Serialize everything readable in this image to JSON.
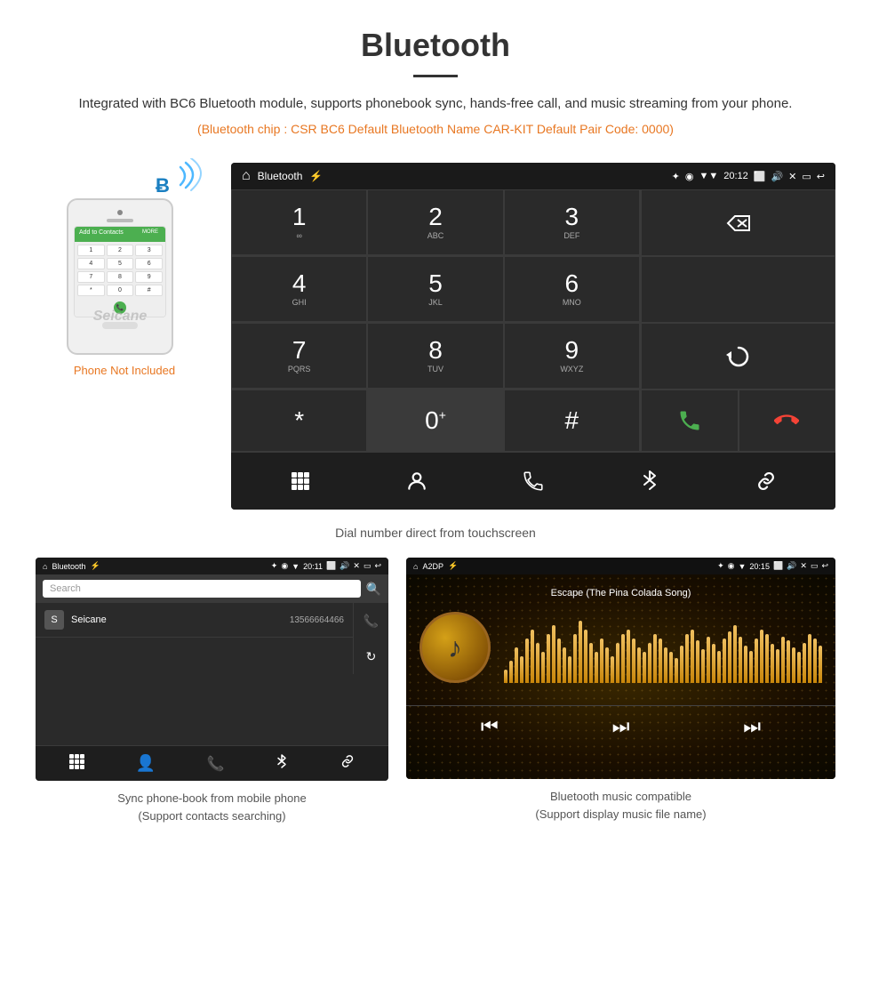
{
  "header": {
    "title": "Bluetooth",
    "description": "Integrated with BC6 Bluetooth module, supports phonebook sync, hands-free call, and music streaming from your phone.",
    "specs": "(Bluetooth chip : CSR BC6    Default Bluetooth Name CAR-KIT    Default Pair Code: 0000)"
  },
  "phone_label": "Phone Not Included",
  "main_display": {
    "status_bar": {
      "home": "⌂",
      "title": "Bluetooth",
      "usb_icon": "⚡",
      "bluetooth": "✦",
      "location": "◉",
      "signal": "▼",
      "time": "20:12",
      "camera": "📷",
      "volume": "🔊",
      "close": "✕",
      "window": "▭",
      "back": "↩"
    },
    "dialpad": [
      {
        "number": "1",
        "letters": "∞"
      },
      {
        "number": "2",
        "letters": "ABC"
      },
      {
        "number": "3",
        "letters": "DEF"
      },
      {
        "number": "",
        "letters": ""
      },
      {
        "number": "",
        "letters": ""
      },
      {
        "number": "4",
        "letters": "GHI"
      },
      {
        "number": "5",
        "letters": "JKL"
      },
      {
        "number": "6",
        "letters": "MNO"
      },
      {
        "number": "",
        "letters": ""
      },
      {
        "number": "",
        "letters": ""
      },
      {
        "number": "7",
        "letters": "PQRS"
      },
      {
        "number": "8",
        "letters": "TUV"
      },
      {
        "number": "9",
        "letters": "WXYZ"
      },
      {
        "number": "",
        "letters": ""
      },
      {
        "number": "",
        "letters": ""
      },
      {
        "number": "*",
        "letters": ""
      },
      {
        "number": "0",
        "letters": "+"
      },
      {
        "number": "#",
        "letters": ""
      },
      {
        "number": "",
        "letters": ""
      },
      {
        "number": "",
        "letters": ""
      }
    ],
    "toolbar_icons": [
      "⊞",
      "👤",
      "📞",
      "✦",
      "🔗"
    ]
  },
  "main_caption": "Dial number direct from touchscreen",
  "phonebook": {
    "status_bar_title": "Bluetooth",
    "time": "20:11",
    "search_placeholder": "Search",
    "contacts": [
      {
        "initial": "S",
        "name": "Seicane",
        "number": "13566664466"
      }
    ],
    "toolbar_icons": [
      "⊞",
      "👤",
      "📞",
      "✦",
      "🔗"
    ]
  },
  "phonebook_caption_line1": "Sync phone-book from mobile phone",
  "phonebook_caption_line2": "(Support contacts searching)",
  "music": {
    "status_bar_title": "A2DP",
    "time": "20:15",
    "song_title": "Escape (The Pina Colada Song)",
    "note_icon": "♪",
    "controls": [
      "⏮",
      "⏭",
      "⏭"
    ]
  },
  "music_caption_line1": "Bluetooth music compatible",
  "music_caption_line2": "(Support display music file name)"
}
